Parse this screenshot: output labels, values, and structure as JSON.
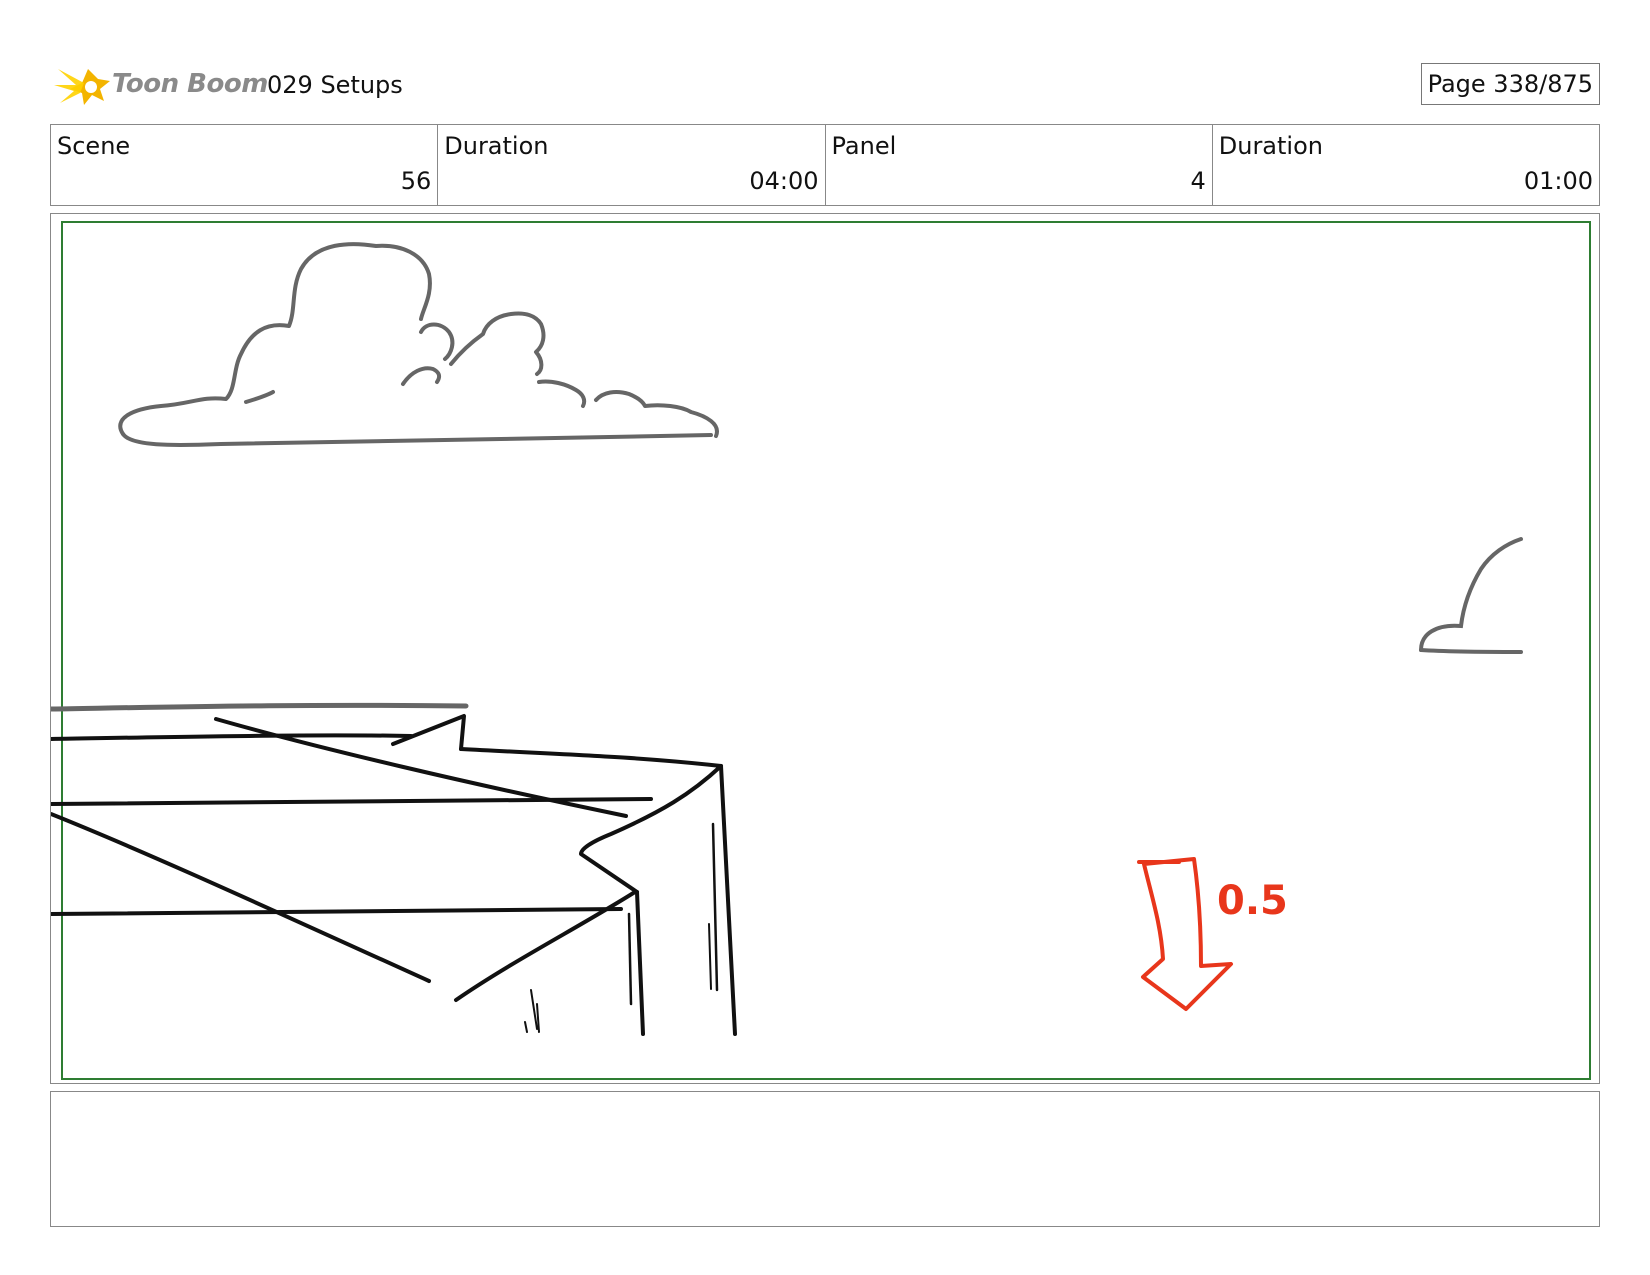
{
  "header": {
    "logo_text": "Toon Boom",
    "project_title": "029 Setups",
    "page_label": "Page 338/875"
  },
  "info": {
    "scene_label": "Scene",
    "scene_value": "56",
    "scene_duration_label": "Duration",
    "scene_duration_value": "04:00",
    "panel_label": "Panel",
    "panel_value": "4",
    "panel_duration_label": "Duration",
    "panel_duration_value": "01:00"
  },
  "panel": {
    "annotation_text": "0.5",
    "safe_frame_color": "#2e7d32",
    "annotation_color": "#e8361b"
  },
  "notes": {}
}
